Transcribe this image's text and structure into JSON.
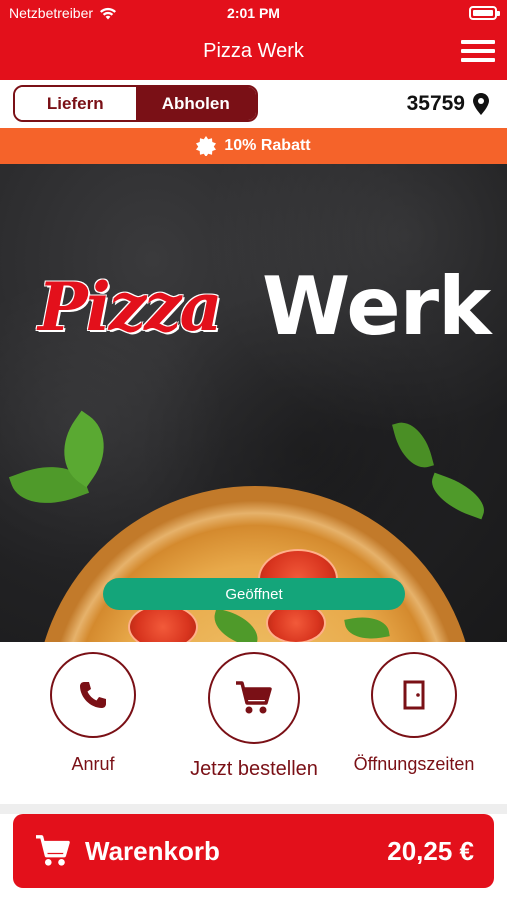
{
  "status_bar": {
    "carrier": "Netzbetreiber",
    "time": "2:01 PM",
    "icons": [
      "wifi-icon",
      "battery-icon"
    ]
  },
  "header": {
    "title": "Pizza Werk",
    "menu_icon": "hamburger-menu-icon"
  },
  "order_mode": {
    "options": [
      "Liefern",
      "Abholen"
    ],
    "selected": "Abholen",
    "postal_code": "35759",
    "location_icon": "map-pin-icon"
  },
  "promo": {
    "icon": "badge-icon",
    "text": "10% Rabatt"
  },
  "hero": {
    "logo_words": [
      "Pizza",
      "Werk"
    ],
    "status_badge": "Geöffnet"
  },
  "actions": [
    {
      "label": "Anruf",
      "icon": "phone-icon"
    },
    {
      "label": "Jetzt bestellen",
      "icon": "cart-icon"
    },
    {
      "label": "Öffnungszeiten",
      "icon": "door-icon"
    }
  ],
  "cart": {
    "label": "Warenkorb",
    "total": "20,25 €",
    "icon": "cart-icon"
  },
  "colors": {
    "brand_red": "#e3101b",
    "dark_red": "#7a1016",
    "promo_orange": "#f5632a",
    "open_green": "#14a57a"
  }
}
